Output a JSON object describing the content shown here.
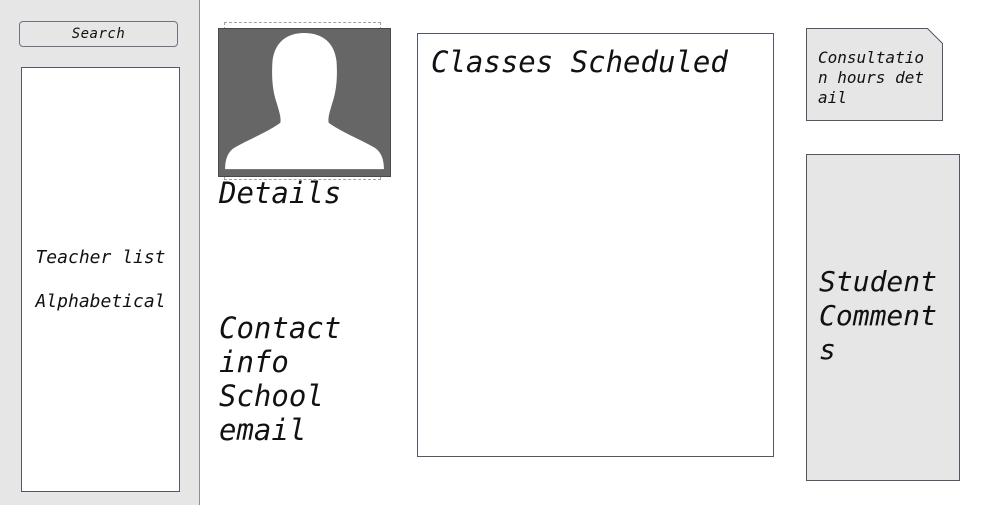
{
  "sidebar": {
    "search_label": "Search",
    "teacher_list": {
      "line1": "Teacher list",
      "line2": "Alphabetical"
    }
  },
  "profile": {
    "avatar_icon": "person-placeholder-icon",
    "details_label": "Details",
    "contact_label": "Contact info School email"
  },
  "classes": {
    "title": "Classes Scheduled"
  },
  "consultation": {
    "text": "Consultation hours detail"
  },
  "comments": {
    "text": "Student Comments"
  },
  "colors": {
    "panel_gray": "#e6e6e6",
    "avatar_gray": "#666666",
    "border": "#4f5a66"
  }
}
